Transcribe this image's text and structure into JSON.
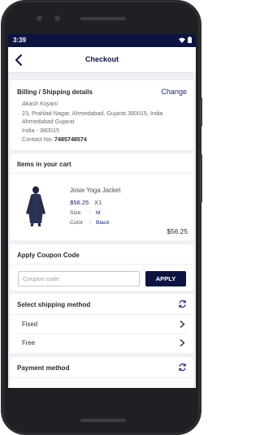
{
  "status_bar": {
    "time": "3:39"
  },
  "app_bar": {
    "title": "Checkout"
  },
  "billing": {
    "title": "Billing / Shipping details",
    "change_label": "Change",
    "name": "Akash Koyani",
    "address_line1": "23, Prahlad Nagar, Ahmedabad, Gujarat 380015, India",
    "address_line2": "Ahmedabad Gujarat",
    "address_line3": "India - 380015",
    "contact_label": "Contact No:",
    "contact_value": "7485748574"
  },
  "cart": {
    "title": "Items in your cart",
    "item": {
      "name": "Josie Yoga Jacket",
      "price": "$56.25",
      "quantity": "X1",
      "size_label": "Size",
      "size_value": "M",
      "color_label": "Color",
      "color_value": "Black",
      "separator": ":",
      "total": "$56.25"
    }
  },
  "coupon": {
    "title": "Apply Coupon Code",
    "placeholder": "Coupon code",
    "value": "",
    "apply_label": "APPLY"
  },
  "shipping": {
    "title": "Select shipping method",
    "options": [
      {
        "label": "Fixed"
      },
      {
        "label": "Free"
      }
    ]
  },
  "payment": {
    "title": "Payment method"
  },
  "colors": {
    "primary": "#0e1441",
    "accent": "#1d2670",
    "background": "#eef0f4"
  },
  "icons": {
    "back": "arrow-left-icon",
    "refresh": "refresh-icon",
    "chevron": "chevron-right-icon",
    "wifi": "wifi-icon",
    "battery": "battery-icon"
  }
}
